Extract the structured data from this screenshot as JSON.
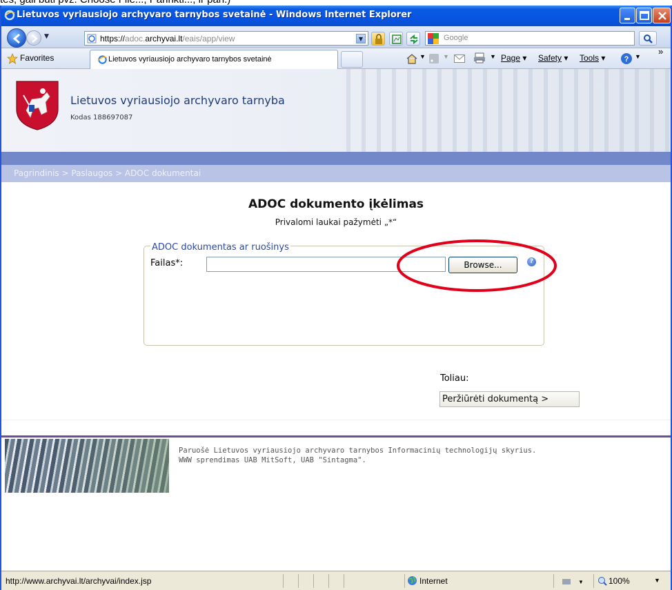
{
  "top_clip_text": "tes, gali būti pvz. Choose File..., Parinkti..., ir pan.)",
  "window": {
    "title": "Lietuvos vyriausiojo archyvaro tarnybos svetainė - Windows Internet Explorer"
  },
  "address": {
    "prefix": "https://",
    "sub": "adoc.",
    "domain": "archyvai.lt",
    "path": "/eais/app/view"
  },
  "search": {
    "placeholder": "Google"
  },
  "favorites": {
    "label": "Favorites",
    "tab_title": "Lietuvos vyriausiojo archyvaro tarnybos svetainė"
  },
  "commands": {
    "page": "Page",
    "safety": "Safety",
    "tools": "Tools"
  },
  "site": {
    "title": "Lietuvos vyriausiojo archyvaro tarnyba",
    "code": "Kodas 188697087",
    "breadcrumb": "Pagrindinis  >  Paslaugos  >  ADOC dokumentai"
  },
  "form": {
    "heading": "ADOC dokumento įkėlimas",
    "required_note": "Privalomi laukai pažymėti „*“",
    "legend": "ADOC dokumentas ar ruošinys",
    "file_label": "Failas*:",
    "file_value": "",
    "browse": "Browse...",
    "help": "?",
    "next_label": "Toliau:",
    "next_button": "Peržiūrėti dokumentą >"
  },
  "footer": {
    "line1": "Paruošė Lietuvos vyriausiojo archyvaro tarnybos Informacinių technologijų skyrius.",
    "line2": "WWW sprendimas UAB MitSoft, UAB \"Sintagma\"."
  },
  "status": {
    "url": "http://www.archyvai.lt/archyvai/index.jsp",
    "zone": "Internet",
    "zoom": "100%"
  },
  "colors": {
    "title_bar": "#0854e3",
    "band": "#7388c9",
    "breadcrumb_bg": "#b8c3e6",
    "annotation": "#e0001a",
    "footer_line": "#6b4d9a"
  },
  "icons": [
    "ie-logo-icon",
    "minimize-icon",
    "maximize-icon",
    "close-icon",
    "back-icon",
    "forward-icon",
    "lock-icon",
    "refresh-icon",
    "stop-icon",
    "google-icon",
    "search-icon",
    "star-icon",
    "home-icon",
    "rss-icon",
    "mail-icon",
    "print-icon",
    "help-icon",
    "globe-icon",
    "zoom-icon",
    "coat-of-arms-icon"
  ]
}
